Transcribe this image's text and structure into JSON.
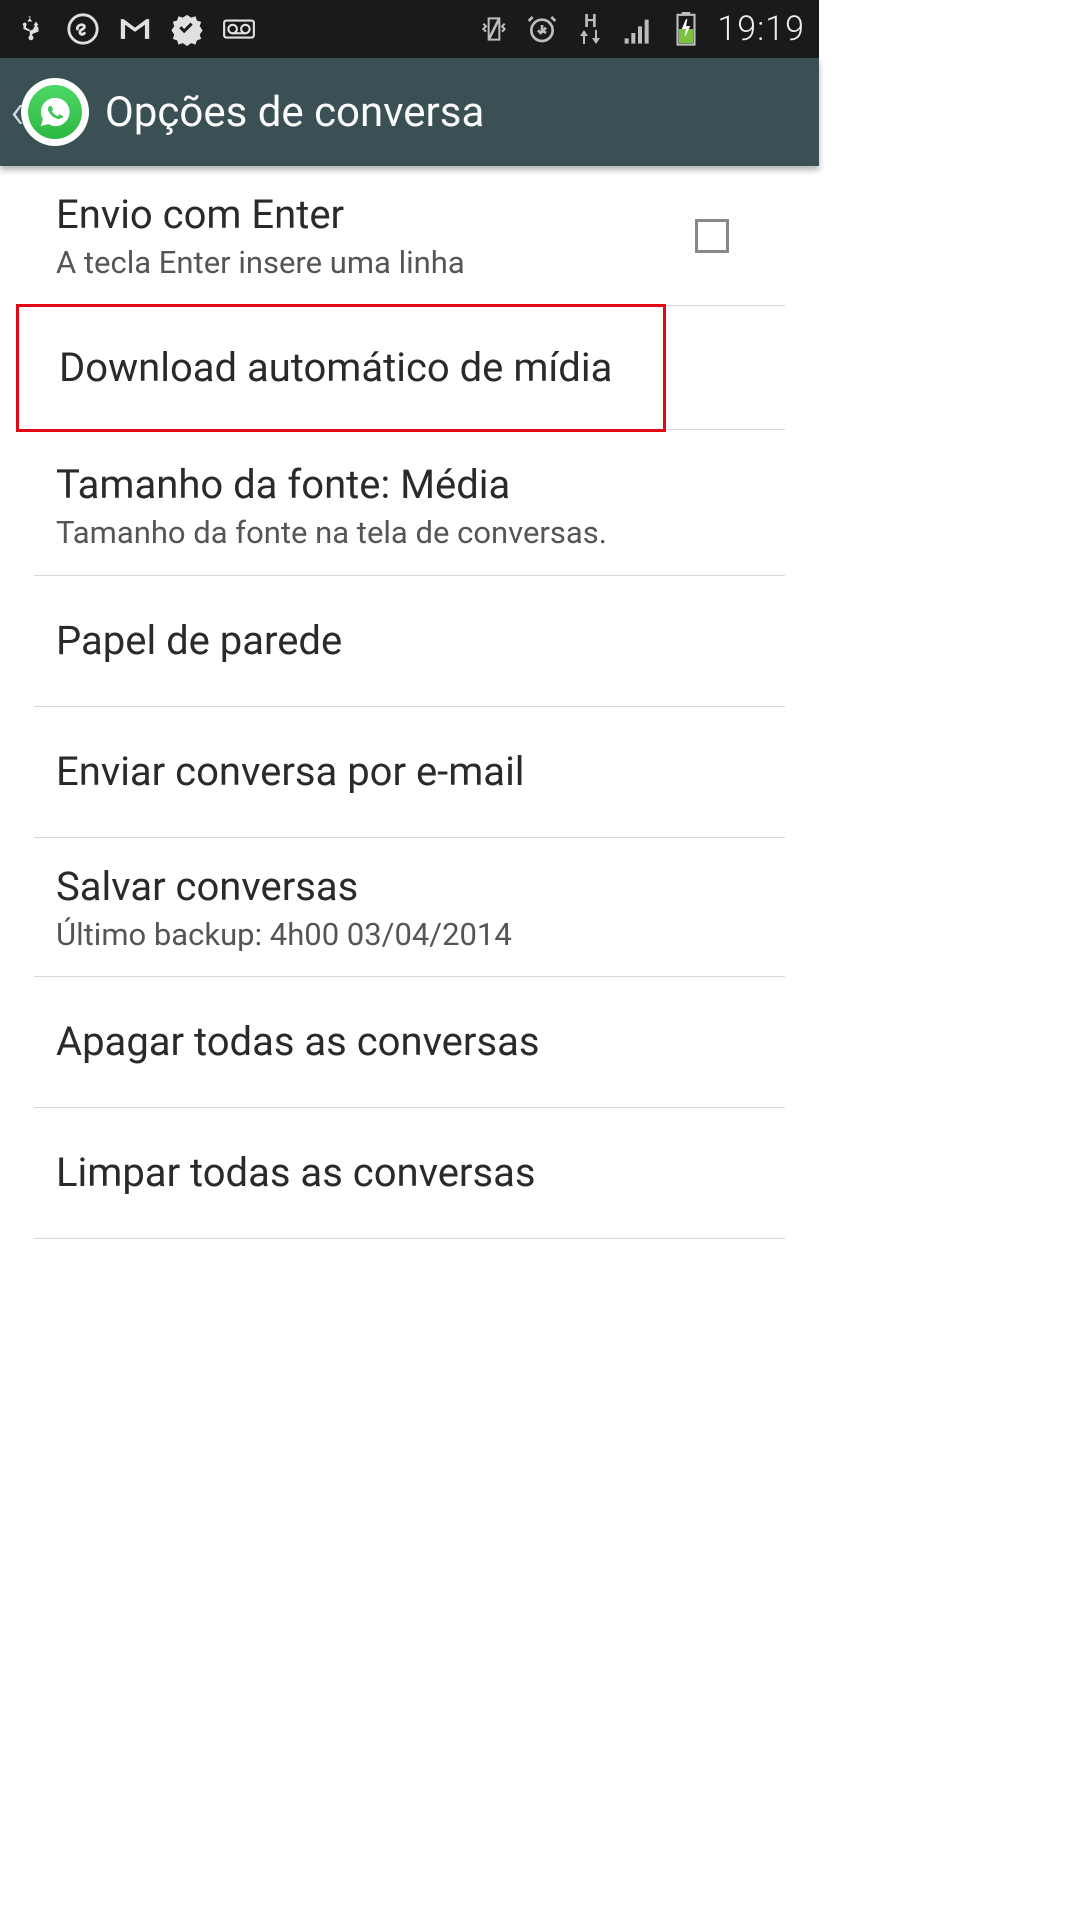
{
  "status_bar": {
    "time": "19:19"
  },
  "header": {
    "title": "Opções de conversa"
  },
  "settings": {
    "enter_send": {
      "title": "Envio com Enter",
      "subtitle": "A tecla Enter insere uma linha"
    },
    "auto_download": {
      "title": "Download automático de mídia"
    },
    "font_size": {
      "title": "Tamanho da fonte: Média",
      "subtitle": "Tamanho da fonte na tela de conversas."
    },
    "wallpaper": {
      "title": "Papel de parede"
    },
    "email_chat": {
      "title": "Enviar conversa por e-mail"
    },
    "backup": {
      "title": "Salvar conversas",
      "subtitle": "Último backup: 4h00 03/04/2014"
    },
    "delete_all": {
      "title": "Apagar todas as conversas"
    },
    "clear_all": {
      "title": "Limpar todas as conversas"
    }
  }
}
